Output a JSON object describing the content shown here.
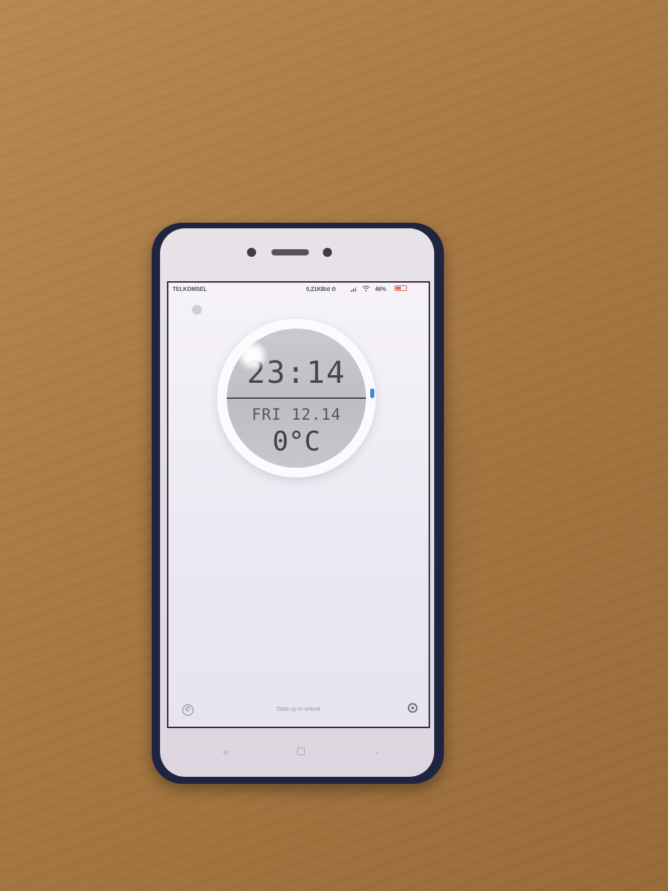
{
  "status_bar": {
    "carrier": "TELKOMSEL",
    "net_speed": "0,21KB/d ⏲",
    "battery_pct": "46%"
  },
  "lock_widget": {
    "time": "23:14",
    "date": "FRI 12.14",
    "temperature": "0°C"
  },
  "lock_footer": {
    "unlock_hint": "Slide up to unlock",
    "phone_glyph": "✆"
  },
  "nav_bar": {
    "menu_glyph": "≡",
    "back_glyph": "‹"
  },
  "colors": {
    "accent_handle": "#3a8bd9",
    "battery_low": "#e25b4a",
    "case": "#1f2440"
  },
  "icons": [
    "settings-icon",
    "signal-icon",
    "wifi-icon",
    "battery-icon",
    "phone-icon",
    "camera-icon",
    "menu-icon",
    "home-icon",
    "back-icon"
  ]
}
